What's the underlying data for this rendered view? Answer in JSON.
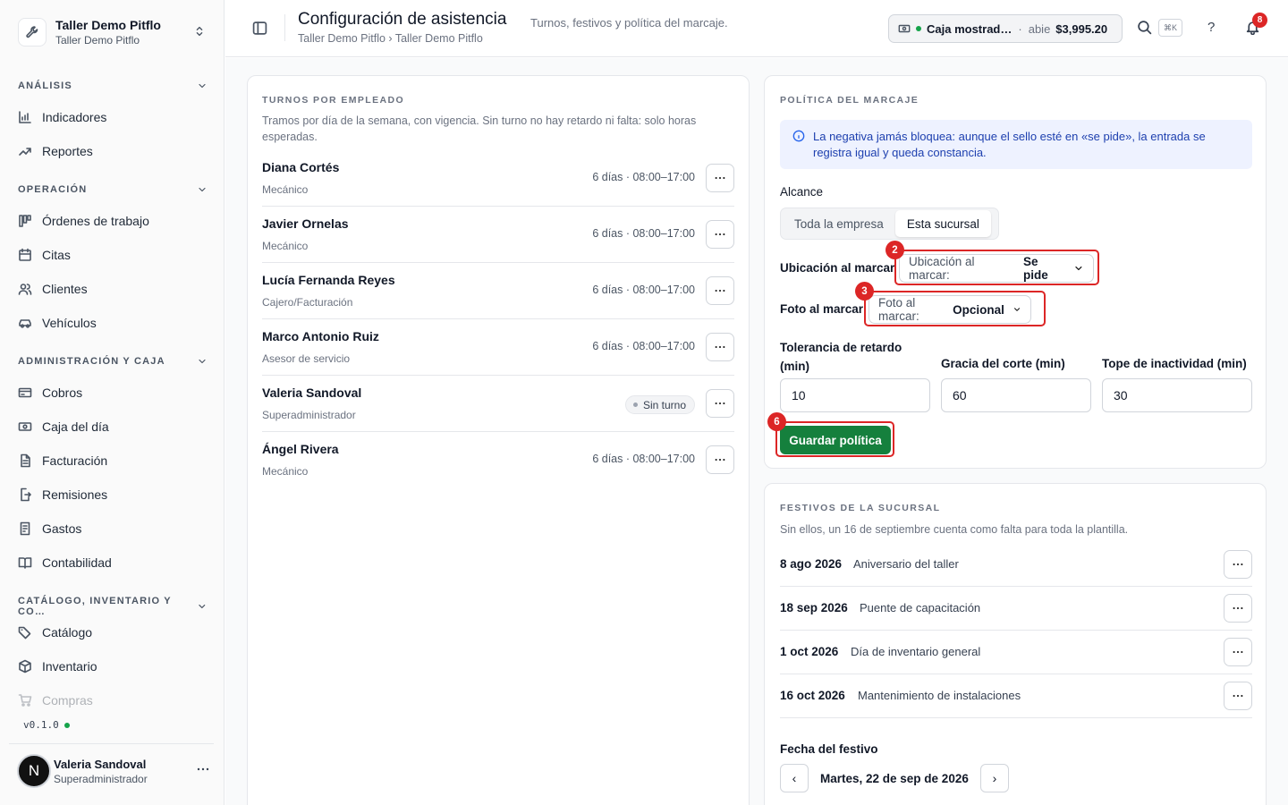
{
  "org": {
    "name": "Taller Demo Pitflo",
    "subtitle": "Taller Demo Pitflo"
  },
  "sidebar": {
    "sections": [
      {
        "title": "ANÁLISIS",
        "items": [
          {
            "label": "Indicadores",
            "icon": "chart-bars-icon"
          },
          {
            "label": "Reportes",
            "icon": "trend-icon"
          }
        ]
      },
      {
        "title": "OPERACIÓN",
        "items": [
          {
            "label": "Órdenes de trabajo",
            "icon": "kanban-icon"
          },
          {
            "label": "Citas",
            "icon": "calendar-icon"
          },
          {
            "label": "Clientes",
            "icon": "users-icon"
          },
          {
            "label": "Vehículos",
            "icon": "car-icon"
          }
        ]
      },
      {
        "title": "ADMINISTRACIÓN Y CAJA",
        "items": [
          {
            "label": "Cobros",
            "icon": "credit-card-icon"
          },
          {
            "label": "Caja del día",
            "icon": "cash-icon"
          },
          {
            "label": "Facturación",
            "icon": "document-icon"
          },
          {
            "label": "Remisiones",
            "icon": "export-icon"
          },
          {
            "label": "Gastos",
            "icon": "receipt-icon"
          },
          {
            "label": "Contabilidad",
            "icon": "book-icon"
          }
        ]
      },
      {
        "title": "CATÁLOGO, INVENTARIO Y CO…",
        "items": [
          {
            "label": "Catálogo",
            "icon": "tags-icon"
          },
          {
            "label": "Inventario",
            "icon": "box-icon"
          },
          {
            "label": "Compras",
            "icon": "cart-icon"
          }
        ]
      }
    ],
    "version": "v0.1.0",
    "user": {
      "initial": "N",
      "name": "Valeria Sandoval",
      "role": "Superadministrador"
    }
  },
  "header": {
    "title": "Configuración de asistencia",
    "subtitle": "Turnos, festivos y política del marcaje.",
    "breadcrumb": "Taller Demo Pitflo › Taller Demo Pitflo",
    "cash": {
      "name": "Caja mostrad…",
      "separator": "·",
      "status": "abie",
      "amount": "$3,995.20"
    },
    "search_shortcut": "⌘K",
    "help": "?",
    "notifications": "8"
  },
  "shifts": {
    "title": "TURNOS POR EMPLEADO",
    "description": "Tramos por día de la semana, con vigencia. Sin turno no hay retardo ni falta: solo horas esperadas.",
    "employees": [
      {
        "name": "Diana Cortés",
        "role": "Mecánico",
        "schedule": "6 días · 08:00–17:00"
      },
      {
        "name": "Javier Ornelas",
        "role": "Mecánico",
        "schedule": "6 días · 08:00–17:00"
      },
      {
        "name": "Lucía Fernanda Reyes",
        "role": "Cajero/Facturación",
        "schedule": "6 días · 08:00–17:00"
      },
      {
        "name": "Marco Antonio Ruiz",
        "role": "Asesor de servicio",
        "schedule": "6 días · 08:00–17:00"
      },
      {
        "name": "Valeria Sandoval",
        "role": "Superadministrador",
        "badge": "Sin turno"
      },
      {
        "name": "Ángel Rivera",
        "role": "Mecánico",
        "schedule": "6 días · 08:00–17:00"
      }
    ]
  },
  "policy": {
    "title": "POLÍTICA DEL MARCAJE",
    "info": "La negativa jamás bloquea: aunque el sello esté en «se pide», la entrada se registra igual y queda constancia.",
    "scope_label": "Alcance",
    "scope_options": [
      "Toda la empresa",
      "Esta sucursal"
    ],
    "scope_selected": "Esta sucursal",
    "location_label": "Ubicación al marcar",
    "location_select_prefix": "Ubicación al marcar:",
    "location_value": "Se pide",
    "photo_label": "Foto al marcar",
    "photo_select_prefix": "Foto al marcar:",
    "photo_value": "Opcional",
    "tolerance_label": "Tolerancia de retardo (min)",
    "tolerance_value": "10",
    "grace_label": "Gracia del corte (min)",
    "grace_value": "60",
    "inactivity_label": "Tope de inactividad (min)",
    "inactivity_value": "30",
    "save_label": "Guardar política",
    "markers": [
      "2",
      "3",
      "6"
    ]
  },
  "holidays": {
    "title": "FESTIVOS DE LA SUCURSAL",
    "description": "Sin ellos, un 16 de septiembre cuenta como falta para toda la plantilla.",
    "items": [
      {
        "date": "8 ago 2026",
        "name": "Aniversario del taller"
      },
      {
        "date": "18 sep 2026",
        "name": "Puente de capacitación"
      },
      {
        "date": "1 oct 2026",
        "name": "Día de inventario general"
      },
      {
        "date": "16 oct 2026",
        "name": "Mantenimiento de instalaciones"
      }
    ],
    "date_label": "Fecha del festivo",
    "date_value": "Martes, 22 de sep de 2026",
    "prev": "‹",
    "next": "›"
  },
  "colors": {
    "primary": "#15803d",
    "highlight": "#dc2626",
    "info_bg": "#eef2ff",
    "info_text": "#1e40af"
  }
}
